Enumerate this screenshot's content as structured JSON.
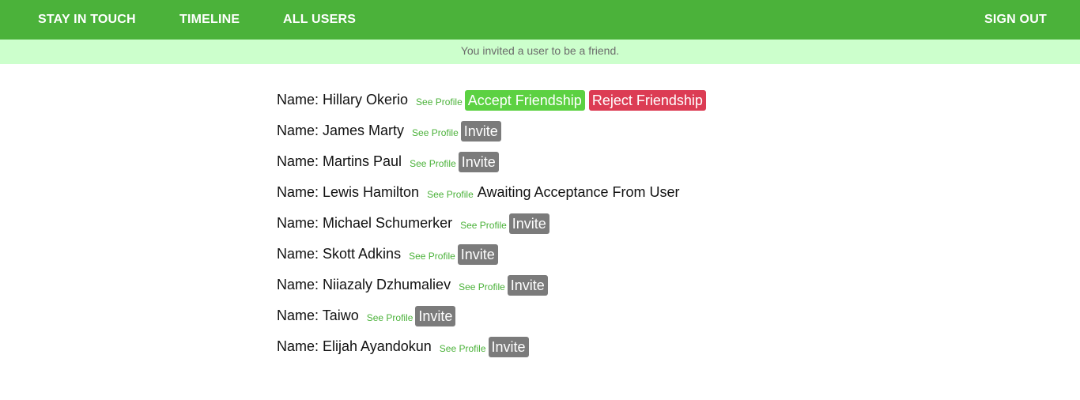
{
  "nav": {
    "brand": "STAY IN TOUCH",
    "timeline": "TIMELINE",
    "all_users": "ALL USERS",
    "sign_out": "SIGN OUT"
  },
  "notice": "You invited a user to be a friend.",
  "users": [
    {
      "name_label": "Name: Hillary Okerio",
      "profile_label": "See Profile",
      "accept_label": "Accept Friendship",
      "reject_label": "Reject Friendship"
    },
    {
      "name_label": "Name: James Marty",
      "profile_label": "See Profile",
      "invite_label": "Invite"
    },
    {
      "name_label": "Name: Martins Paul",
      "profile_label": "See Profile",
      "invite_label": "Invite"
    },
    {
      "name_label": "Name: Lewis Hamilton",
      "profile_label": "See Profile",
      "status_label": "Awaiting Acceptance From User"
    },
    {
      "name_label": "Name: Michael Schumerker",
      "profile_label": "See Profile",
      "invite_label": "Invite"
    },
    {
      "name_label": "Name: Skott Adkins",
      "profile_label": "See Profile",
      "invite_label": "Invite"
    },
    {
      "name_label": "Name: Niiazaly Dzhumaliev",
      "profile_label": "See Profile",
      "invite_label": "Invite"
    },
    {
      "name_label": "Name: Taiwo",
      "profile_label": "See Profile",
      "invite_label": "Invite"
    },
    {
      "name_label": "Name: Elijah Ayandokun",
      "profile_label": "See Profile",
      "invite_label": "Invite"
    }
  ],
  "colors": {
    "navbar": "#4bb23a",
    "notice_bg": "#ccffcc",
    "link": "#4bb23a",
    "invite": "#7b7b7b",
    "accept": "#5cd142",
    "reject": "#dc3c54"
  }
}
